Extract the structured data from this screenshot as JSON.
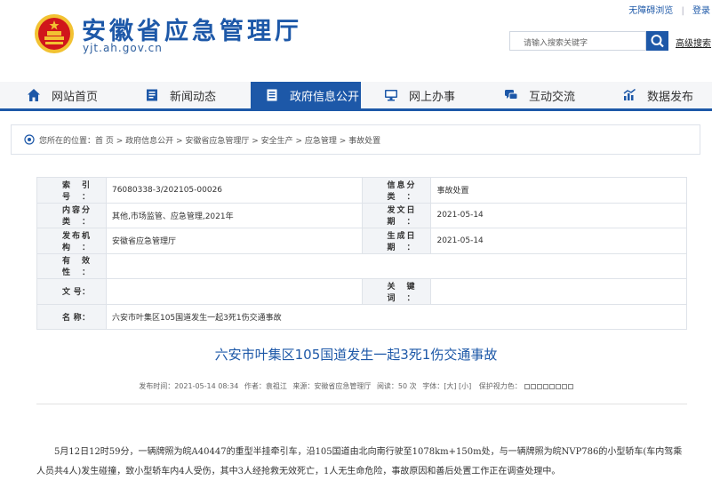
{
  "header": {
    "title": "安徽省应急管理厅",
    "domain": "yjt.ah.gov.cn",
    "accessibility_link": "无障碍浏览",
    "login_link": "登录",
    "search_placeholder": "请输入搜索关键字",
    "advanced_search": "高级搜索"
  },
  "nav": {
    "items": [
      {
        "label": "网站首页",
        "icon": "home-icon"
      },
      {
        "label": "新闻动态",
        "icon": "news-icon"
      },
      {
        "label": "政府信息公开",
        "icon": "document-icon",
        "active": true
      },
      {
        "label": "网上办事",
        "icon": "monitor-icon"
      },
      {
        "label": "互动交流",
        "icon": "chat-icon"
      },
      {
        "label": "数据发布",
        "icon": "chart-icon"
      }
    ]
  },
  "breadcrumb": {
    "text": "您所在的位置：首 页 > 政府信息公开 > 安徽省应急管理厅 > 安全生产 > 应急管理 > 事故处置"
  },
  "info": {
    "index_label": "索 引 号：",
    "index_value": "76080338-3/202105-00026",
    "category_label": "信息分类：",
    "category_value": "事故处置",
    "content_label": "内容分类：",
    "content_value": "其他,市场监管、应急管理,2021年",
    "date_label": "发文日期：",
    "date_value": "2021-05-14",
    "publisher_label": "发布机构：",
    "publisher_value": "安徽省应急管理厅",
    "gen_label": "生成日期：",
    "gen_value": "2021-05-14",
    "validity_label": "有 效 性：",
    "validity_value": "",
    "docno_label": "文 号：",
    "docno_value": "",
    "keyword_label": "关 键 词：",
    "keyword_value": "",
    "name_label": "名 称：",
    "name_value": "六安市叶集区105国道发生一起3死1伤交通事故"
  },
  "article": {
    "title": "六安市叶集区105国道发生一起3死1伤交通事故",
    "meta_published": "发布时间：2021-05-14 08:34",
    "meta_author": "作者：袁祖江",
    "meta_source": "来源：安徽省应急管理厅",
    "meta_reads": "阅读：50 次",
    "meta_font": "字体：[大] [小]",
    "meta_protect": "保护视力色：",
    "body": "5月12日12时59分，一辆牌照为皖A40447的重型半挂牵引车，沿105国道由北向南行驶至1078km+150m处，与一辆牌照为皖NVP786的小型轿车(车内驾乘人员共4人)发生碰撞，致小型轿车内4人受伤，其中3人经抢救无效死亡，1人无生命危险，事故原因和善后处置工作正在调查处理中。"
  },
  "colors": {
    "brand": "#1d58a8",
    "emblem_red": "#d0161b",
    "emblem_gold": "#f2c232"
  }
}
